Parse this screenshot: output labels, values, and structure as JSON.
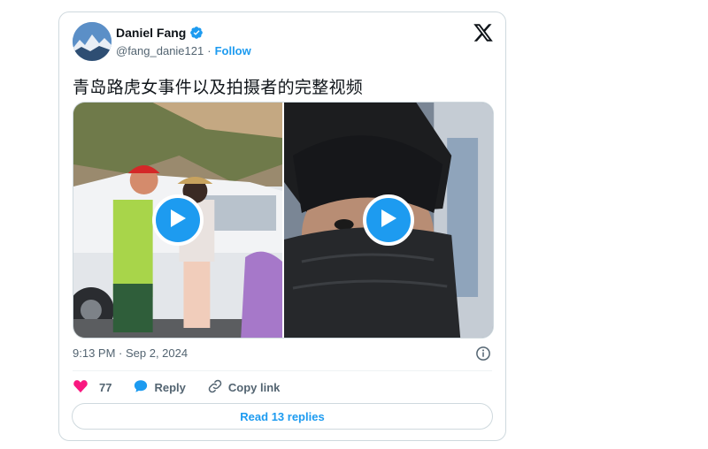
{
  "author": {
    "display_name": "Daniel Fang",
    "handle": "@fang_danie121",
    "separator": "·",
    "follow_label": "Follow"
  },
  "tweet": {
    "text": "青岛路虎女事件以及拍摄者的完整视频",
    "timestamp": "9:13 PM · Sep 2, 2024"
  },
  "media": {
    "videos": [
      {
        "icon": "play-icon"
      },
      {
        "icon": "play-icon"
      }
    ]
  },
  "actions": {
    "likes_count": "77",
    "reply_label": "Reply",
    "copy_link_label": "Copy link"
  },
  "footer": {
    "read_replies_label": "Read 13 replies"
  },
  "colors": {
    "accent": "#1d9bf0",
    "like": "#f91880",
    "text_secondary": "#536471",
    "border": "#cfd9de"
  }
}
